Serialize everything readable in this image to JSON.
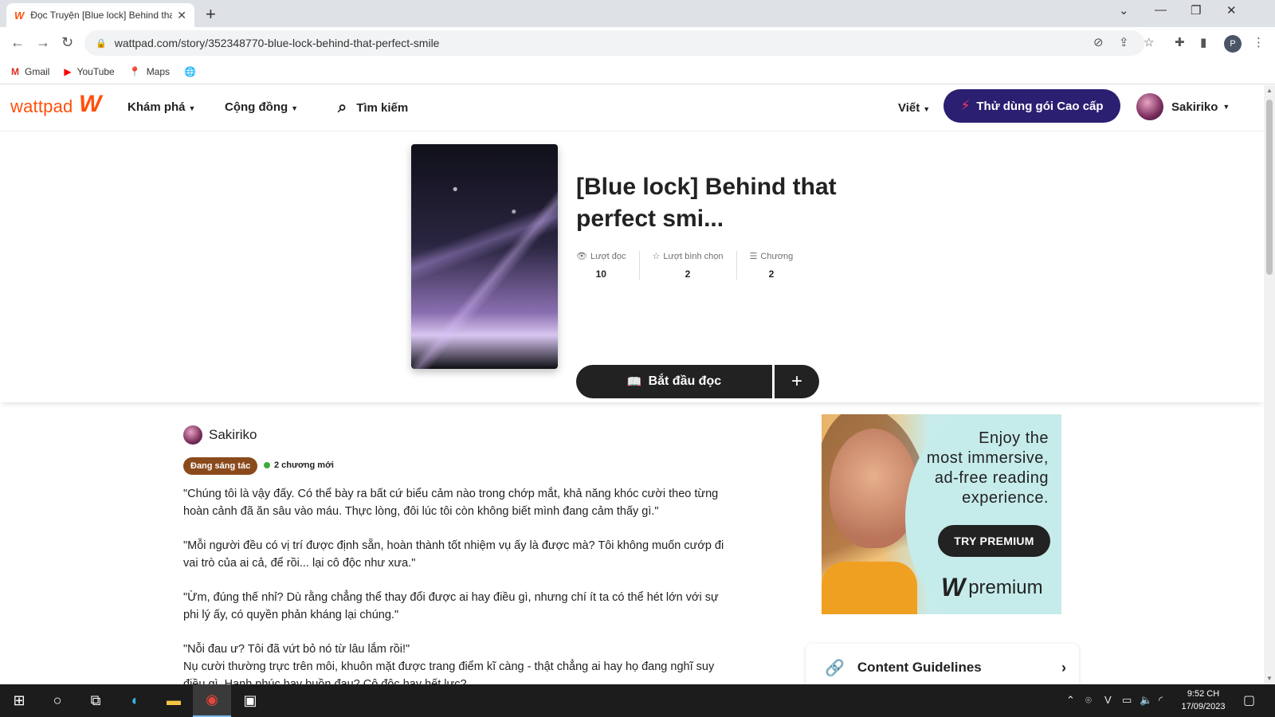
{
  "browser": {
    "tab_title": "Đọc Truyện [Blue lock] Behind that perfect smile",
    "url": "wattpad.com/story/352348770-blue-lock-behind-that-perfect-smile",
    "bookmarks": [
      {
        "label": "Gmail",
        "icon": "gmail-icon"
      },
      {
        "label": "YouTube",
        "icon": "youtube-icon"
      },
      {
        "label": "Maps",
        "icon": "maps-icon"
      }
    ],
    "profile_initial": "P"
  },
  "header": {
    "logo": "wattpad",
    "nav": [
      {
        "label": "Khám phá"
      },
      {
        "label": "Cộng đồng"
      }
    ],
    "search_label": "Tìm kiếm",
    "write_label": "Viết",
    "premium_cta": "Thử dùng gói Cao cấp",
    "username": "Sakiriko"
  },
  "story": {
    "title": "[Blue lock] Behind that perfect smi...",
    "stats": [
      {
        "label": "Lượt đọc",
        "value": "10",
        "icon": "eye-icon"
      },
      {
        "label": "Lượt bình chọn",
        "value": "2",
        "icon": "star-icon"
      },
      {
        "label": "Chương",
        "value": "2",
        "icon": "list-icon"
      }
    ],
    "start_reading": "Bắt đầu đọc",
    "add_symbol": "+",
    "author": "Sakiriko",
    "status_tag": "Đang sáng tác",
    "new_chapters": "2 chương mới",
    "description": [
      "\"Chúng tôi là vậy đấy. Có thể bày ra bất cứ biểu cảm nào trong chớp mắt, khả năng khóc cười theo từng hoàn cảnh đã ăn sâu vào máu. Thực lòng, đôi lúc tôi còn không biết mình đang cảm thấy gì.\"",
      "\"Mỗi người đều có vị trí được định sẵn, hoàn thành tốt nhiệm vụ ấy là được mà? Tôi không muốn cướp đi vai trò của ai cả, để rồi... lại cô độc như xưa.\"",
      "\"Ừm, đúng thế nhỉ? Dù rằng chẳng thể thay đổi được ai hay điều gì, nhưng chí ít ta có thể hét lớn với sự phi lý ấy, có quyền phản kháng lại chúng.\"",
      "\"Nỗi đau ư? Tôi đã vứt bỏ nó từ lâu lắm rồi!\"",
      "Nụ cười thường trực trên môi, khuôn mặt được trang điểm kĩ càng - thật chẳng ai hay họ đang nghĩ suy điều gì. Hạnh phúc hay buồn đau? Cô độc hay hết lực?"
    ]
  },
  "ad": {
    "copy_lines": [
      "Enjoy the",
      "most immersive,",
      "ad-free reading",
      "experience."
    ],
    "button": "TRY PREMIUM",
    "brand": "premium"
  },
  "sidebar": {
    "content_guidelines": "Content Guidelines"
  },
  "taskbar": {
    "time": "9:52 CH",
    "date": "17/09/2023"
  },
  "colors": {
    "brand_orange": "#ff500a",
    "premium_purple": "#2b1f72",
    "status_brown": "#8a4a1c",
    "new_dot_green": "#3dad3d"
  }
}
